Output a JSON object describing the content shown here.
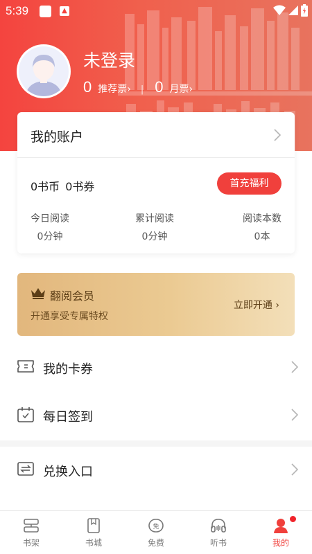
{
  "status_bar": {
    "time": "5:39",
    "icons": [
      "notification-square-icon",
      "app-a-icon",
      "wifi-icon",
      "signal-icon",
      "battery-icon"
    ]
  },
  "profile": {
    "name": "未登录",
    "recommend_count": "0",
    "recommend_label": "推荐票›",
    "month_count": "0",
    "month_label": "月票›"
  },
  "account": {
    "title": "我的账户",
    "coins": "0书币",
    "vouchers": "0书券",
    "recharge_button": "首充福利",
    "stats": [
      {
        "label": "今日阅读",
        "value": "0分钟"
      },
      {
        "label": "累计阅读",
        "value": "0分钟"
      },
      {
        "label": "阅读本数",
        "value": "0本"
      }
    ]
  },
  "vip": {
    "title": "翻阅会员",
    "subtitle": "开通享受专属特权",
    "action": "立即开通 ›"
  },
  "menu": [
    {
      "label": "我的卡券",
      "icon": "ticket-icon"
    },
    {
      "label": "每日签到",
      "icon": "calendar-icon"
    },
    {
      "label": "兑换入口",
      "icon": "exchange-icon"
    }
  ],
  "bottom_nav": [
    {
      "label": "书架",
      "icon": "bookshelf-icon"
    },
    {
      "label": "书城",
      "icon": "book-store-icon"
    },
    {
      "label": "免费",
      "icon": "free-icon"
    },
    {
      "label": "听书",
      "icon": "headphones-icon"
    },
    {
      "label": "我的",
      "icon": "profile-icon",
      "active": true
    }
  ],
  "colors": {
    "accent": "#f0403c",
    "vip_gold": "#e2b77d",
    "header_red": "#f4443f"
  }
}
